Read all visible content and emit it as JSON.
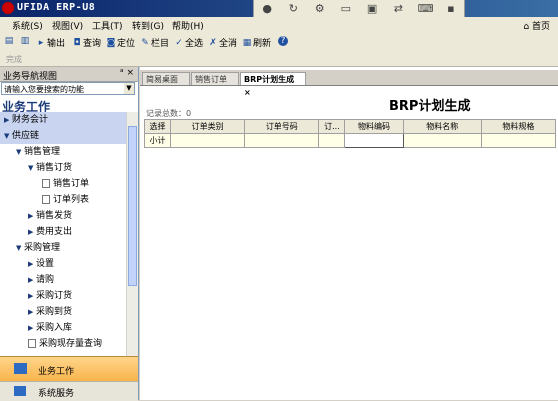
{
  "window": {
    "title": "UFIDA ERP-U8"
  },
  "remote_toolbar": {
    "icons": [
      "record-icon",
      "refresh-icon",
      "gear-icon",
      "chat-icon",
      "monitor-icon",
      "transfer-icon",
      "keyboard-icon",
      "pin-icon"
    ]
  },
  "menu": {
    "items": [
      "系统(S)",
      "视图(V)",
      "工具(T)",
      "转到(G)",
      "帮助(H)"
    ],
    "home_label": "首页"
  },
  "toolbar": {
    "buttons": [
      "输出",
      "查询",
      "定位",
      "栏目",
      "全选",
      "全消",
      "刷新"
    ],
    "sub_label": "完成"
  },
  "nav": {
    "panel_title": "业务导航视图",
    "pin": "ᵃ",
    "close": "×",
    "search_placeholder": "请输入您要搜索的功能",
    "section_title": "业务工作",
    "items": [
      {
        "label": "财务会计",
        "level": 0,
        "expanded": false
      },
      {
        "label": "供应链",
        "level": 0,
        "expanded": true
      },
      {
        "label": "销售管理",
        "level": 1,
        "expanded": true
      },
      {
        "label": "销售订货",
        "level": 2,
        "expanded": true
      },
      {
        "label": "销售订单",
        "level": 3,
        "doc": true
      },
      {
        "label": "订单列表",
        "level": 3,
        "doc": true
      },
      {
        "label": "销售发货",
        "level": 2,
        "expanded": false
      },
      {
        "label": "费用支出",
        "level": 2,
        "expanded": false
      },
      {
        "label": "采购管理",
        "level": 1,
        "expanded": true
      },
      {
        "label": "设置",
        "level": 2,
        "expanded": false
      },
      {
        "label": "请购",
        "level": 2,
        "expanded": false
      },
      {
        "label": "采购订货",
        "level": 2,
        "expanded": false
      },
      {
        "label": "采购到货",
        "level": 2,
        "expanded": false
      },
      {
        "label": "采购入库",
        "level": 2,
        "expanded": false
      },
      {
        "label": "采购现存量查询",
        "level": 2,
        "doc": true
      }
    ],
    "bottom_primary": "业务工作",
    "bottom_secondary": "系统服务"
  },
  "main": {
    "tabs": [
      "简易桌面",
      "销售订单",
      "BRP计划生成"
    ],
    "active_tab": "BRP计划生成",
    "record_count_label": "记录总数：0",
    "page_title": "BRP计划生成",
    "grid": {
      "headers": [
        "选择",
        "订单类别",
        "订单号码",
        "订...",
        "物料编码",
        "物料名称",
        "物料规格"
      ],
      "subtotal_label": "小计"
    }
  }
}
